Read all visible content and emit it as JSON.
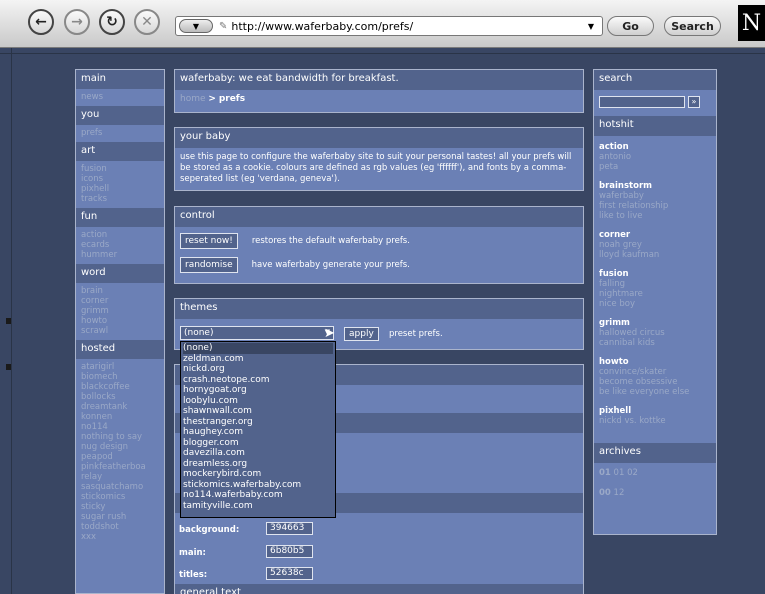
{
  "browser": {
    "url": "http://www.waferbaby.com/prefs/",
    "go_label": "Go",
    "search_label": "Search",
    "brand_letter": "N"
  },
  "nav": {
    "sections": [
      {
        "header": "main",
        "items": [
          "news"
        ]
      },
      {
        "header": "you",
        "items": [
          "prefs"
        ]
      },
      {
        "header": "art",
        "items": [
          "fusion",
          "icons",
          "pixhell",
          "tracks"
        ]
      },
      {
        "header": "fun",
        "items": [
          "action",
          "ecards",
          "hummer"
        ]
      },
      {
        "header": "word",
        "items": [
          "brain",
          "corner",
          "grimm",
          "howto",
          "scrawl"
        ]
      },
      {
        "header": "hosted",
        "items": [
          "atarigirl",
          "biomech",
          "blackcoffee",
          "bollocks",
          "dreamtank",
          "konnen",
          "no114",
          "nothing to say",
          "nug design",
          "peapod",
          "pinkfeatherboa",
          "relay",
          "sasquatchamo",
          "stickomics",
          "sticky",
          "sugar rush",
          "toddshot",
          "xxx"
        ]
      }
    ]
  },
  "main": {
    "title": "waferbaby: we eat bandwidth for breakfast.",
    "crumb_home": "home",
    "crumb_sep": ">",
    "crumb_current": "prefs",
    "yourbaby_title": "your baby",
    "yourbaby_text": "use this page to configure the waferbaby site to suit your personal tastes! all your prefs will be stored as a cookie. colours are defined as rgb values (eg 'ffffff'), and fonts by a comma-seperated list (eg 'verdana, geneva').",
    "control_title": "control",
    "reset_label": "reset now!",
    "reset_desc": "restores the default waferbaby prefs.",
    "randomise_label": "randomise",
    "randomise_desc": "have waferbaby generate your prefs.",
    "themes_title": "themes",
    "theme_selected": "(none)",
    "apply_label": "apply",
    "apply_desc": "preset prefs.",
    "theme_options": [
      "(none)",
      "zeldman.com",
      "nickd.org",
      "crash.neotope.com",
      "hornygoat.org",
      "loobylu.com",
      "shawnwall.com",
      "thestranger.org",
      "haughey.com",
      "blogger.com",
      "davezilla.com",
      "dreamless.org",
      "mockerybird.com",
      "stickomics.waferbaby.com",
      "no114.waferbaby.com",
      "tamityville.com"
    ],
    "background_label": "background:",
    "background_value": "394663",
    "main_label": "main:",
    "main_value": "6b80b5",
    "titles_label": "titles:",
    "titles_value": "52638c",
    "general_text_label": "general text"
  },
  "right": {
    "search_title": "search",
    "search_go": "»",
    "hotshit_title": "hotshit",
    "hotshit": [
      {
        "title": "action",
        "items": [
          "antonio",
          "peta"
        ]
      },
      {
        "title": "brainstorm",
        "items": [
          "waferbaby",
          "first relationship",
          "like to live"
        ]
      },
      {
        "title": "corner",
        "items": [
          "noah grey",
          "lloyd kaufman"
        ]
      },
      {
        "title": "fusion",
        "items": [
          "falling",
          "nightmare",
          "nice boy"
        ]
      },
      {
        "title": "grimm",
        "items": [
          "hallowed circus",
          "cannibal kids"
        ]
      },
      {
        "title": "howto",
        "items": [
          "convince/skater",
          "become obsessive",
          "be like everyone else"
        ]
      },
      {
        "title": "pixhell",
        "items": [
          "nickd vs. kottke"
        ]
      }
    ],
    "archives_title": "archives",
    "archive_rows": [
      {
        "year": "01",
        "months": "01 02"
      },
      {
        "year": "00",
        "months": "12"
      }
    ]
  },
  "colors": {
    "background": "#394663",
    "main": "#6b80b5",
    "titles": "#52638c"
  }
}
